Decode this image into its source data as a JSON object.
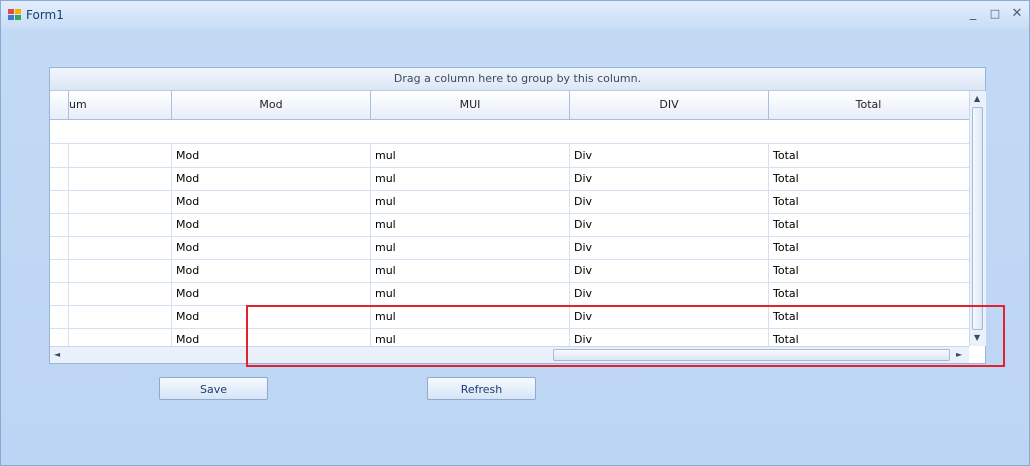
{
  "window": {
    "title": "Form1",
    "minimize_glyph": "_",
    "maximize_glyph": "□",
    "close_glyph": "✕",
    "icon": "form-app-icon"
  },
  "grid": {
    "group_panel_text": "Drag a column here to group by this column.",
    "columns": [
      "um",
      "Mod",
      "MUI",
      "DIV",
      "Total"
    ],
    "rows": [
      [
        "",
        "Mod",
        "mul",
        "Div",
        "Total"
      ],
      [
        "",
        "Mod",
        "mul",
        "Div",
        "Total"
      ],
      [
        "",
        "Mod",
        "mul",
        "Div",
        "Total"
      ],
      [
        "",
        "Mod",
        "mul",
        "Div",
        "Total"
      ],
      [
        "",
        "Mod",
        "mul",
        "Div",
        "Total"
      ],
      [
        "",
        "Mod",
        "mul",
        "Div",
        "Total"
      ],
      [
        "",
        "Mod",
        "mul",
        "Div",
        "Total"
      ],
      [
        "",
        "Mod",
        "mul",
        "Div",
        "Total"
      ],
      [
        "",
        "Mod",
        "mul",
        "Div",
        "Total"
      ]
    ],
    "scroll_arrows": {
      "up": "▲",
      "down": "▼",
      "left": "◄",
      "right": "►"
    }
  },
  "buttons": {
    "save": "Save",
    "refresh": "Refresh"
  },
  "colors": {
    "highlight_border": "#e0232e",
    "window_background": "#c3daf5"
  }
}
